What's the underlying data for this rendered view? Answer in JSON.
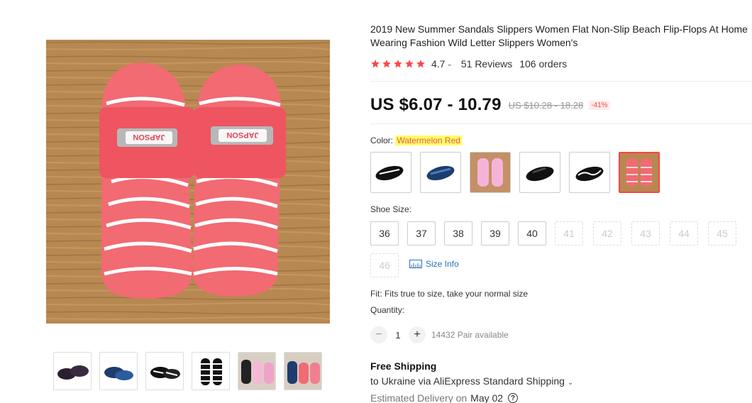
{
  "product": {
    "title_line1": "2019 New Summer Sandals Slippers Women Flat Non-Slip Beach Flip-Flops At Home",
    "title_line2": "Wearing Fashion Wild Letter Slippers Women's",
    "rating": "4.7",
    "reviews": "51 Reviews",
    "orders": "106 orders",
    "price": "US $6.07 - 10.79",
    "old_price": "US $10.28 - 18.28",
    "discount": "-41%",
    "brand_print": "JAPSON"
  },
  "colors": {
    "accent": "#ff4747",
    "star": "#ff4747",
    "link": "#2a70b8",
    "highlight": "#ffff66"
  },
  "color_option": {
    "label": "Color:",
    "selected": "Watermelon Red",
    "swatches": [
      "black-white slipper",
      "blue-black slipper",
      "pink slipper",
      "black slipper",
      "black-white wave slipper",
      "watermelon red slipper"
    ]
  },
  "thumbnails": [
    "black slippers",
    "blue slippers",
    "black-white slippers",
    "black-white striped slippers",
    "pink and black pairs",
    "blue and red pairs"
  ],
  "shoe_size": {
    "label": "Shoe Size:",
    "sizes": [
      "36",
      "37",
      "38",
      "39",
      "40",
      "41",
      "42",
      "43",
      "44",
      "45",
      "46"
    ],
    "available": [
      "36",
      "37",
      "38",
      "39",
      "40"
    ]
  },
  "size_info": "Size Info",
  "fit": "Fit: Fits true to size, take your normal size",
  "quantity": {
    "label": "Quantity:",
    "value": "1",
    "minus": "−",
    "plus": "+",
    "available": "14432 Pair available"
  },
  "shipping": {
    "title": "Free Shipping",
    "line": "to Ukraine via AliExpress Standard Shipping",
    "delivery_label": "Estimated Delivery on",
    "delivery_date": "May 02",
    "help": "?"
  }
}
